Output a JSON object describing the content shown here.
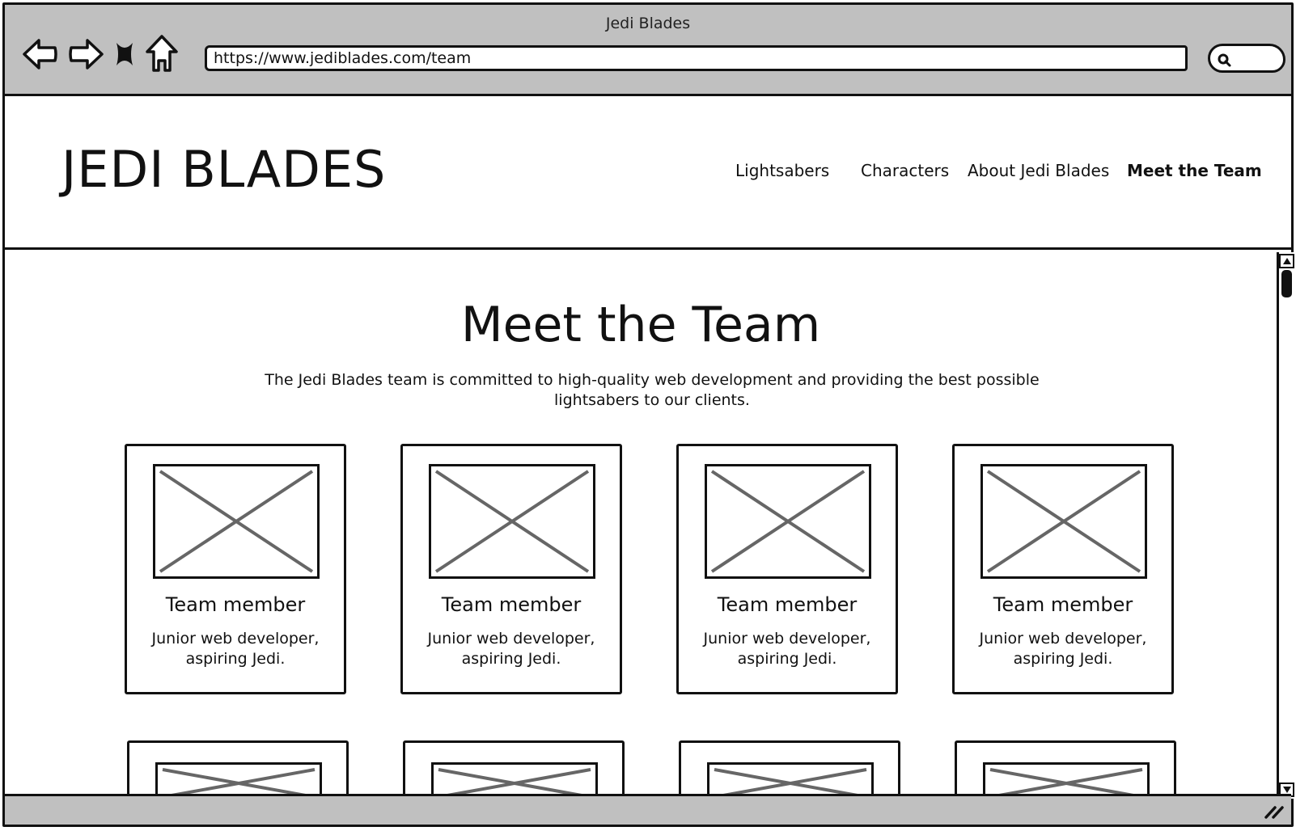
{
  "window": {
    "title": "Jedi Blades"
  },
  "browser": {
    "url": "https://www.jediblades.com/team",
    "icons": [
      "back-arrow-icon",
      "forward-arrow-icon",
      "stop-icon",
      "home-icon",
      "search-icon"
    ]
  },
  "site": {
    "logo": "JEDI BLADES",
    "nav": [
      {
        "label": "Lightsabers",
        "active": false
      },
      {
        "label": "Characters",
        "active": false
      },
      {
        "label": "About Jedi Blades",
        "active": false
      },
      {
        "label": "Meet the Team",
        "active": true
      }
    ]
  },
  "main": {
    "title": "Meet the Team",
    "intro": "The Jedi Blades team is committed to high-quality web development and providing the best possible lightsabers to our clients.",
    "members": [
      {
        "name": "Team member",
        "role": "Junior web developer, aspiring Jedi.",
        "image": "image-placeholder"
      },
      {
        "name": "Team member",
        "role": "Junior web developer, aspiring Jedi.",
        "image": "image-placeholder"
      },
      {
        "name": "Team member",
        "role": "Junior web developer, aspiring Jedi.",
        "image": "image-placeholder"
      },
      {
        "name": "Team member",
        "role": "Junior web developer, aspiring Jedi.",
        "image": "image-placeholder"
      }
    ],
    "second_row_partial_cards": 4
  },
  "colors": {
    "chrome": "#c0c0c0",
    "ink": "#111111",
    "placeholder_cross": "#666666",
    "background": "#ffffff"
  }
}
